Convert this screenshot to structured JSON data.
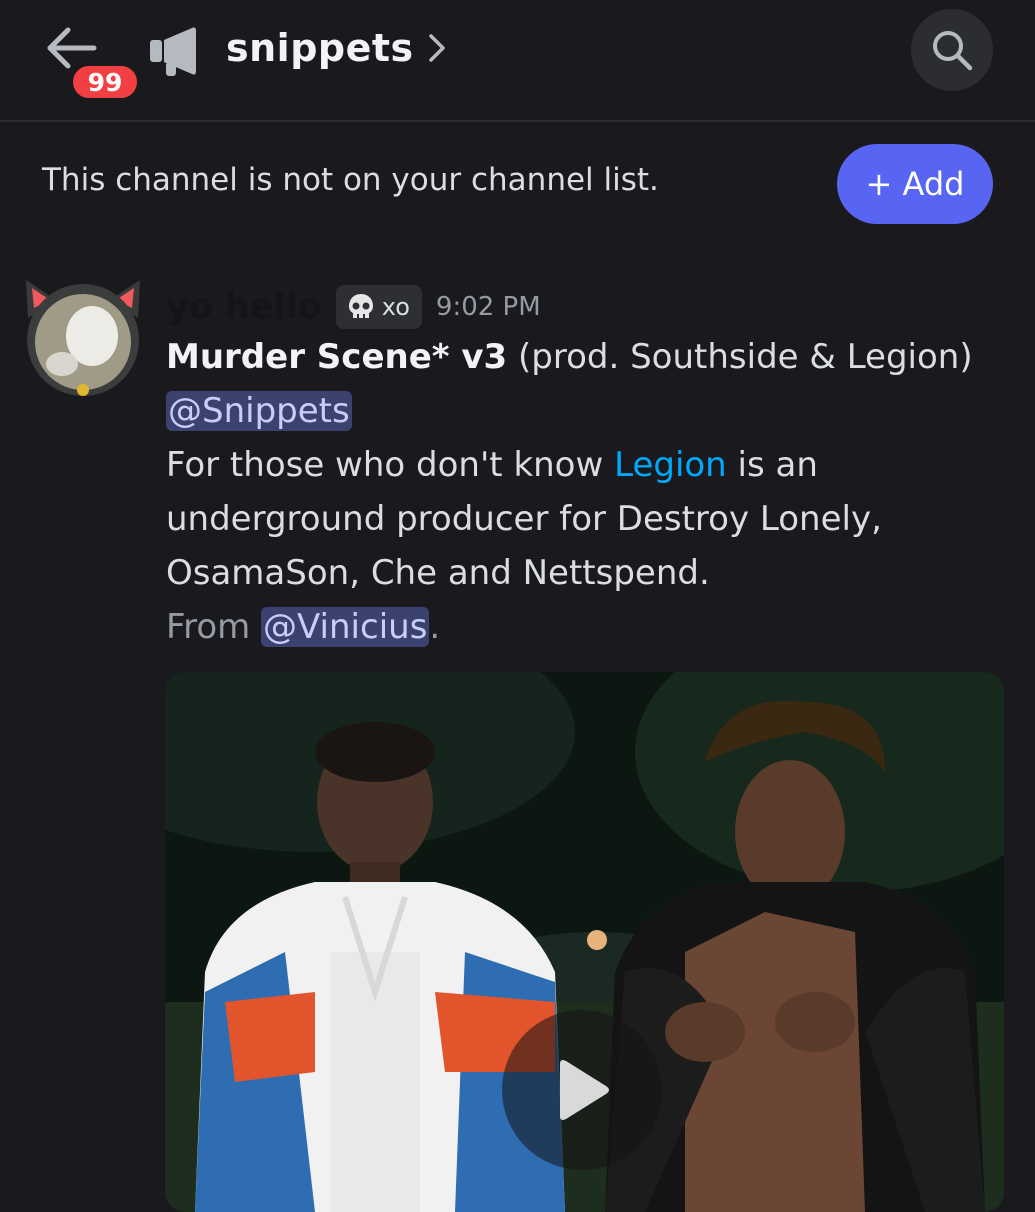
{
  "header": {
    "back_badge": "99",
    "channel_name": "snippets",
    "icons": [
      "arrow-left-icon",
      "megaphone-icon",
      "chevron-right-icon",
      "search-icon"
    ]
  },
  "notice": {
    "text": "This channel is not on your channel list.",
    "add_label": "+ Add"
  },
  "message": {
    "username": "yo hello",
    "tag": "xo",
    "tag_icon": "skull-icon",
    "time": "9:02 PM",
    "title_bold": "Murder Scene* v3",
    "title_rest": " (prod. Southside & Legion)",
    "mention_role": "@Snippets",
    "body_prefix": "For those who don't know ",
    "body_link": "Legion",
    "body_suffix": " is an",
    "body_line2": "underground producer for Destroy Lonely,",
    "body_line3": "OsamaSon, Che and Nettspend.",
    "from_prefix": "From ",
    "from_mention": "@Vinicius",
    "from_suffix": "."
  },
  "colors": {
    "background": "#1a1a1e",
    "accent": "#5865f2",
    "badge": "#f23f43",
    "link": "#00a8fc",
    "mention_bg": "#3c4270"
  }
}
